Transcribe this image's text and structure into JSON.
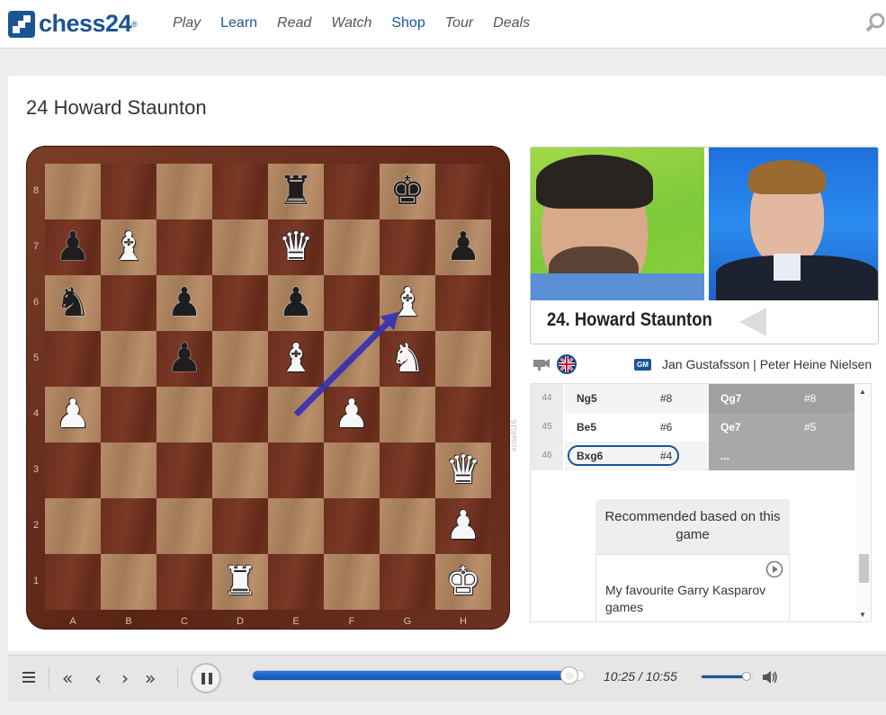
{
  "header": {
    "logo_text": "chess24",
    "logo_tm": "®",
    "nav": [
      {
        "label": "Play",
        "highlight": false
      },
      {
        "label": "Learn",
        "highlight": true
      },
      {
        "label": "Read",
        "highlight": false
      },
      {
        "label": "Watch",
        "highlight": false
      },
      {
        "label": "Shop",
        "highlight": true
      },
      {
        "label": "Tour",
        "highlight": false
      },
      {
        "label": "Deals",
        "highlight": false
      }
    ],
    "search_icon": "search-icon"
  },
  "page": {
    "title": "24 Howard Staunton"
  },
  "board": {
    "ranks": [
      "8",
      "7",
      "6",
      "5",
      "4",
      "3",
      "2",
      "1"
    ],
    "files": [
      "A",
      "B",
      "C",
      "D",
      "E",
      "F",
      "G",
      "H"
    ],
    "pieces": [
      {
        "square": "e8",
        "color": "b",
        "type": "rook",
        "glyph": "♜"
      },
      {
        "square": "g8",
        "color": "b",
        "type": "king",
        "glyph": "♚"
      },
      {
        "square": "a7",
        "color": "b",
        "type": "pawn",
        "glyph": "♟"
      },
      {
        "square": "b7",
        "color": "w",
        "type": "bishop",
        "glyph": "♝"
      },
      {
        "square": "e7",
        "color": "w",
        "type": "queen",
        "glyph": "♛"
      },
      {
        "square": "h7",
        "color": "b",
        "type": "pawn",
        "glyph": "♟"
      },
      {
        "square": "a6",
        "color": "b",
        "type": "knight",
        "glyph": "♞"
      },
      {
        "square": "c6",
        "color": "b",
        "type": "pawn",
        "glyph": "♟"
      },
      {
        "square": "e6",
        "color": "b",
        "type": "pawn",
        "glyph": "♟"
      },
      {
        "square": "g6",
        "color": "w",
        "type": "bishop",
        "glyph": "♝"
      },
      {
        "square": "c5",
        "color": "b",
        "type": "pawn",
        "glyph": "♟"
      },
      {
        "square": "e5",
        "color": "w",
        "type": "bishop",
        "glyph": "♝"
      },
      {
        "square": "g5",
        "color": "w",
        "type": "knight",
        "glyph": "♞"
      },
      {
        "square": "a4",
        "color": "w",
        "type": "pawn",
        "glyph": "♟"
      },
      {
        "square": "f4",
        "color": "w",
        "type": "pawn",
        "glyph": "♟"
      },
      {
        "square": "h3",
        "color": "w",
        "type": "queen",
        "glyph": "♛"
      },
      {
        "square": "h2",
        "color": "w",
        "type": "pawn",
        "glyph": "♟"
      },
      {
        "square": "d1",
        "color": "w",
        "type": "rook",
        "glyph": "♜"
      },
      {
        "square": "h1",
        "color": "w",
        "type": "king",
        "glyph": "♚"
      }
    ],
    "arrow": {
      "from": "e4",
      "to": "g6",
      "color": "#2a2ab8"
    }
  },
  "video": {
    "caption": "24. Howard Staunton"
  },
  "info": {
    "title_badge": "GM",
    "commentators": "Jan Gustafsson | Peter Heine Nielsen",
    "side_code": "ecda4516"
  },
  "moves": [
    {
      "num": "44",
      "white": "Ng5",
      "white_time": "#8",
      "black": "Qg7",
      "black_time": "#8",
      "current": false
    },
    {
      "num": "45",
      "white": "Be5",
      "white_time": "#6",
      "black": "Qe7",
      "black_time": "#5",
      "current": false
    },
    {
      "num": "46",
      "white": "Bxg6",
      "white_time": "#4",
      "black": "...",
      "black_time": "",
      "current": true
    }
  ],
  "recommendation": {
    "title": "Recommended based on this game",
    "item": "My favourite Garry Kasparov games"
  },
  "player": {
    "time_current": "10:25",
    "time_sep": "/",
    "time_total": "10:55",
    "progress": 0.953,
    "volume": 0.88,
    "accent": "#1a5494"
  }
}
